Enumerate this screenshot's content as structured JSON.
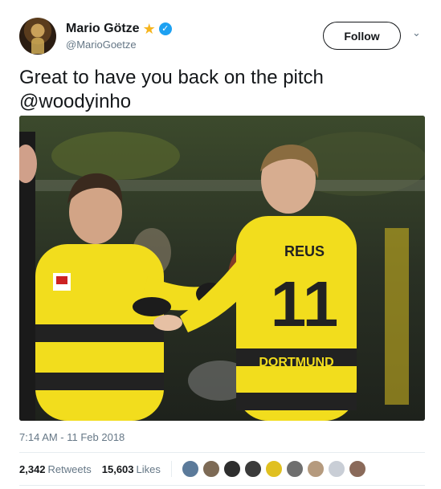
{
  "tweet": {
    "author": {
      "name": "Mario Götze",
      "handle": "@MarioGoetze",
      "star_icon": "★",
      "verified_icon": "✓"
    },
    "follow_label": "Follow",
    "caret_icon": "⌄",
    "text": "Great to have you back on the pitch @woodyinho",
    "photo": {
      "jersey_name": "REUS",
      "jersey_number": "11",
      "sponsor_text": "DORTMUND"
    },
    "timestamp": "7:14 AM - 11 Feb 2018",
    "retweets": {
      "count": "2,342",
      "label": "Retweets"
    },
    "likes": {
      "count": "15,603",
      "label": "Likes"
    },
    "likers": [
      {
        "color": "#5b7a9a"
      },
      {
        "color": "#7d6a55"
      },
      {
        "color": "#2e2e2e"
      },
      {
        "color": "#3a3a3a"
      },
      {
        "color": "#e0c020"
      },
      {
        "color": "#6f6f6f"
      },
      {
        "color": "#b59a7e"
      },
      {
        "color": "#c9ced6"
      },
      {
        "color": "#8a6a5a"
      }
    ]
  },
  "colors": {
    "accent": "#1da1f2",
    "star": "#f6b51e",
    "muted": "#657786",
    "bvb_yellow": "#f2dd1d"
  }
}
